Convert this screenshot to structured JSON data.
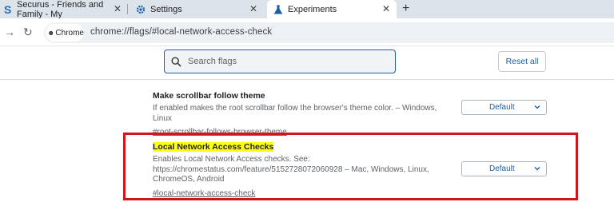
{
  "tabs": [
    {
      "title": "Securus - Friends and Family - My",
      "icon": "securus-s-icon"
    },
    {
      "title": "Settings",
      "icon": "gear-icon"
    },
    {
      "title": "Experiments",
      "icon": "flask-icon"
    }
  ],
  "new_tab_symbol": "+",
  "toolbar": {
    "chip_label": "Chrome",
    "url": "chrome://flags/#local-network-access-check"
  },
  "flags_header": {
    "search_placeholder": "Search flags",
    "reset_label": "Reset all"
  },
  "experiments": [
    {
      "title": "Make scrollbar follow theme",
      "description": "If enabled makes the root scrollbar follow the browser's theme color. – Windows, Linux",
      "link": "#root-scrollbar-follows-browser-theme",
      "select_value": "Default"
    },
    {
      "title": "Local Network Access Checks",
      "description": "Enables Local Network Access checks. See: https://chromestatus.com/feature/5152728072060928 – Mac, Windows, Linux, ChromeOS, Android",
      "link": "#local-network-access-check",
      "select_value": "Default"
    }
  ],
  "colors": {
    "accent": "#1a5ea8",
    "highlight": "#ffff1a",
    "annotation_box": "#d0161c"
  }
}
